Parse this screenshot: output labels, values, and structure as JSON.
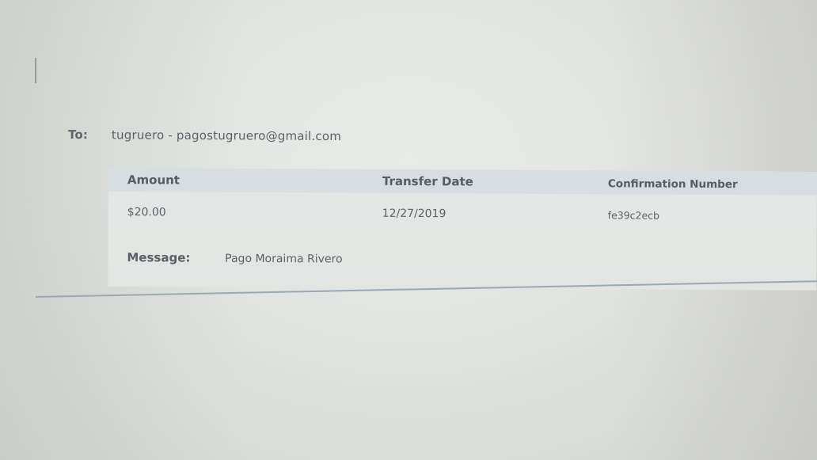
{
  "recipient": {
    "label": "To:",
    "value": "tugruero - pagostugruero@gmail.com"
  },
  "transfer_table": {
    "headers": {
      "amount": "Amount",
      "transfer_date": "Transfer Date",
      "confirmation_number": "Confirmation Number"
    },
    "row": {
      "amount": "$20.00",
      "transfer_date": "12/27/2019",
      "confirmation_number": "fe39c2ecb"
    }
  },
  "message": {
    "label": "Message:",
    "value": "Pago Moraima Rivero"
  },
  "colors": {
    "header_band": "#d8dde2",
    "divider": "#9aa7b7",
    "text": "#555a60"
  }
}
